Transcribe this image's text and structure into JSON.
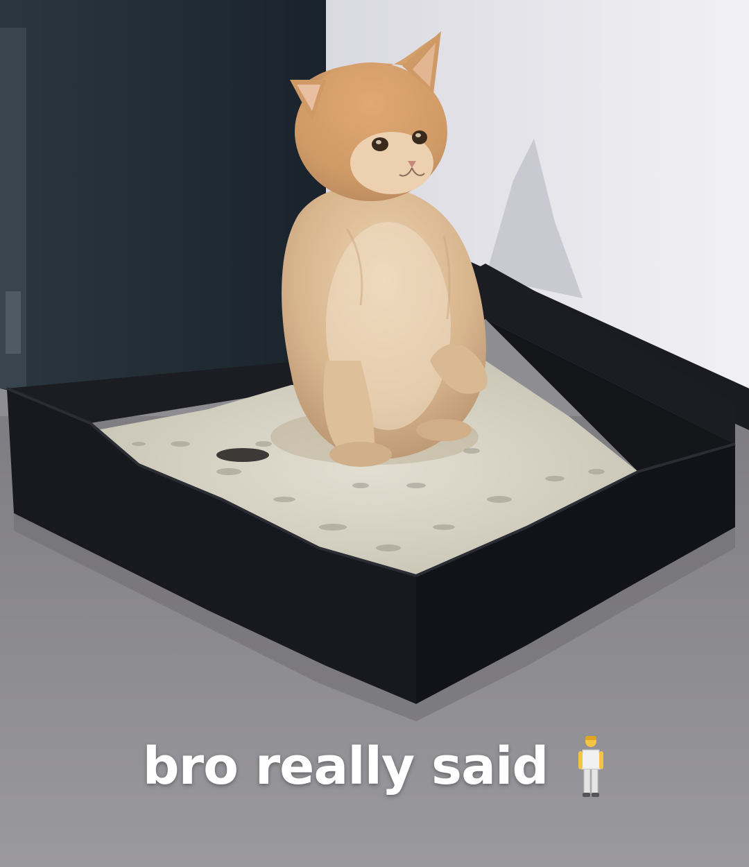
{
  "caption": {
    "text": "bro really said",
    "icon": "standing-person-icon"
  },
  "colors": {
    "caption_text": "#ffffff",
    "wall_dark": "#1f2a33",
    "wall_light": "#e6e6ec",
    "floor": "#8e8d91",
    "box": "#16171c",
    "litter": "#d9d6c8",
    "kitten_fur": "#d9b48a",
    "kitten_head": "#d19a63"
  }
}
